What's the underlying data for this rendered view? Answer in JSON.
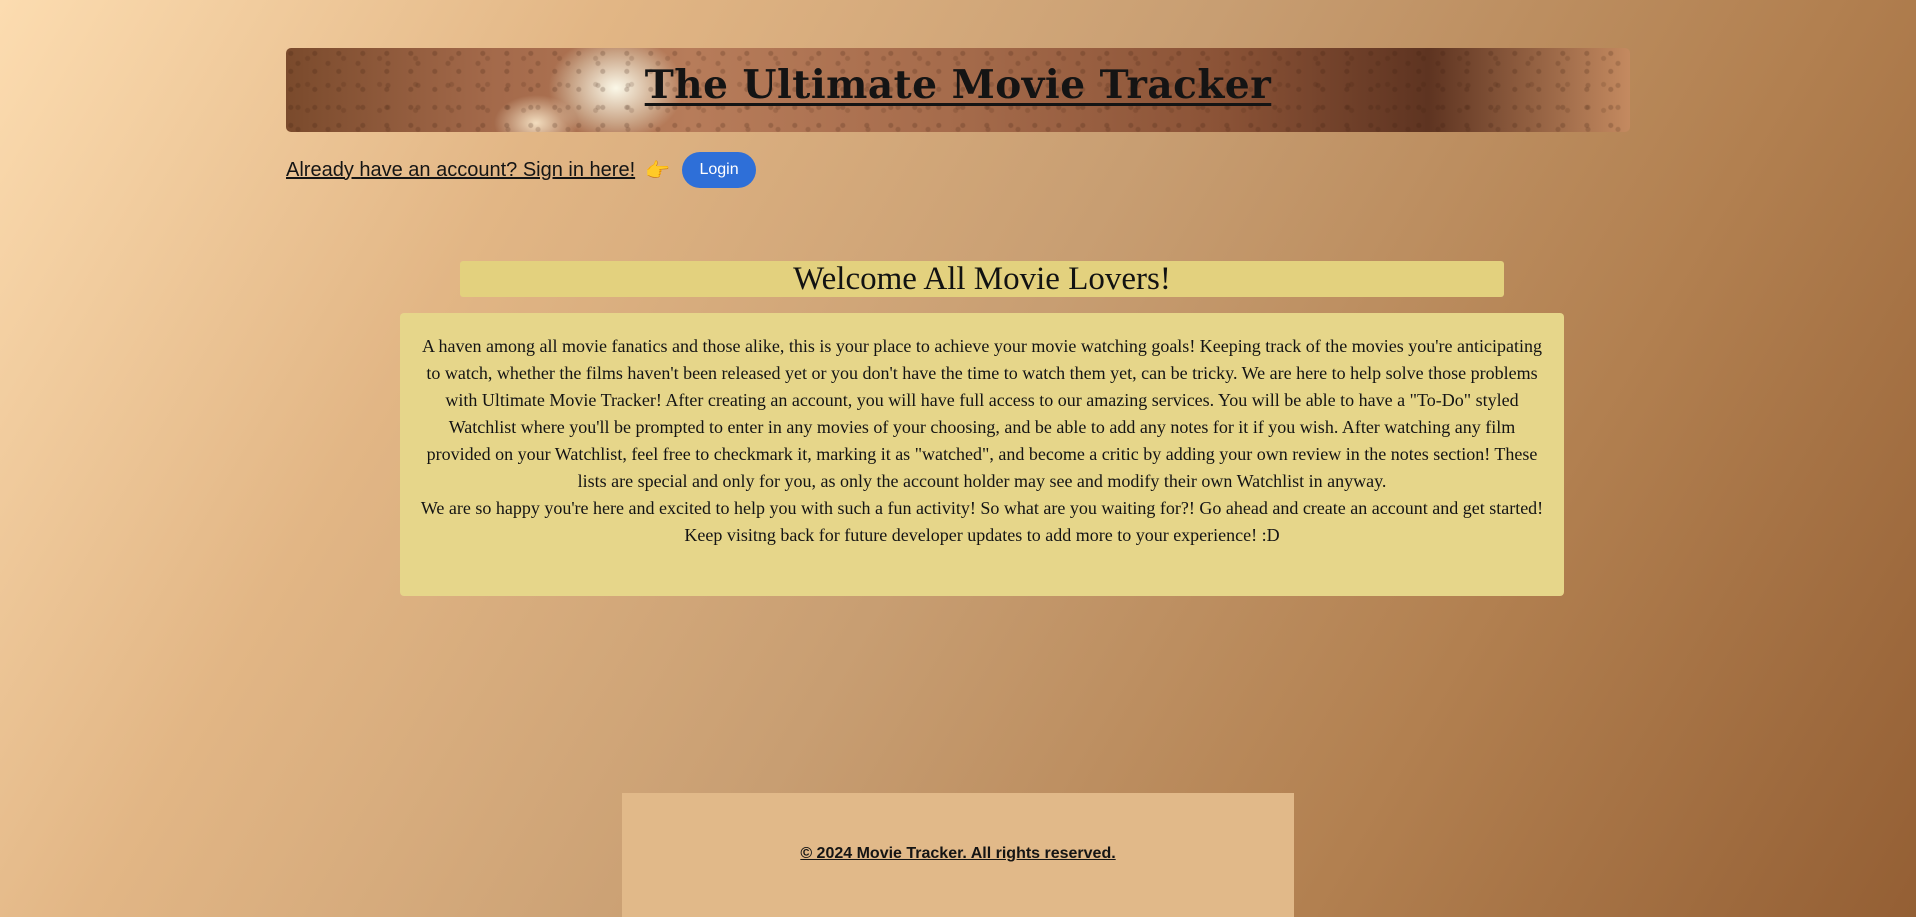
{
  "header": {
    "title": "The Ultimate Movie Tracker"
  },
  "signin": {
    "prompt": "Already have an account? Sign in here!",
    "pointer_emoji": "👉",
    "login_label": "Login"
  },
  "welcome": {
    "heading": "Welcome All Movie Lovers!",
    "paragraph_1": "A haven among all movie fanatics and those alike, this is your place to achieve your movie watching goals! Keeping track of the movies you're anticipating to watch, whether the films haven't been released yet or you don't have the time to watch them yet, can be tricky. We are here to help solve those problems with Ultimate Movie Tracker! After creating an account, you will have full access to our amazing services. You will be able to have a \"To-Do\" styled Watchlist where you'll be prompted to enter in any movies of your choosing, and be able to add any notes for it if you wish. After watching any film provided on your Watchlist, feel free to checkmark it, marking it as \"watched\", and become a critic by adding your own review in the notes section! These lists are special and only for you, as only the account holder may see and modify their own Watchlist in anyway.",
    "paragraph_2": "We are so happy you're here and excited to help you with such a fun activity! So what are you waiting for?! Go ahead and create an account and get started! Keep visitng back for future developer updates to add more to your experience! :D"
  },
  "footer": {
    "copyright": "© 2024 Movie Tracker. All rights reserved."
  },
  "colors": {
    "login_button": "#2e6fd8",
    "welcome_bg": "#e3d17e",
    "description_bg": "#e6d68a",
    "footer_bg": "#e1b989"
  }
}
